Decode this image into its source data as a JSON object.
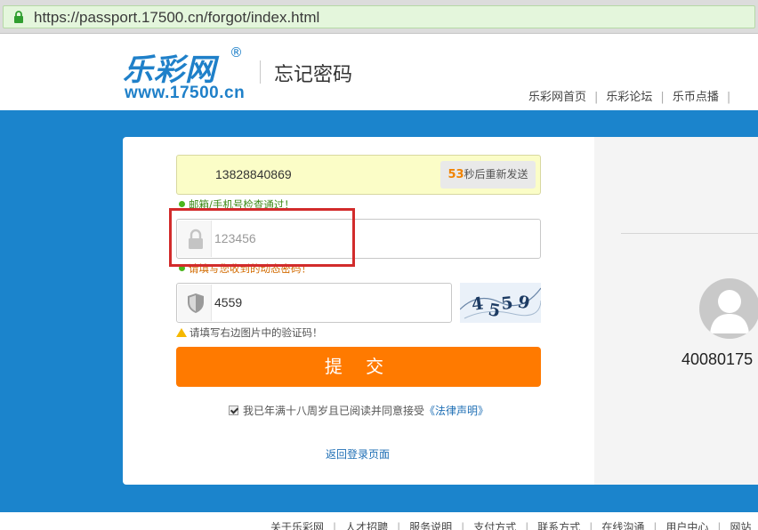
{
  "browser": {
    "url": "https://passport.17500.cn/forgot/index.html"
  },
  "header": {
    "logo_cn": "乐彩网",
    "logo_reg": "®",
    "logo_url": "www.17500.cn",
    "page_title": "忘记密码",
    "nav": [
      "乐彩网首页",
      "乐彩论坛",
      "乐币点播"
    ]
  },
  "form": {
    "phone_value": "13828840869",
    "resend_count": "53",
    "resend_text": "秒后重新发送",
    "phone_check_hint": "邮箱/手机号检查通过！",
    "code_placeholder": "123456",
    "code_hint": "请填写您收到的动态密码！",
    "captcha_value": "4559",
    "captcha_hint": "请填写右边图片中的验证码！",
    "captcha_image_text": "4559",
    "submit_label": "提 交",
    "agree_text": "我已年满十八周岁且已阅读并同意接受",
    "agree_link": "《法律声明》",
    "back_link": "返回登录页面"
  },
  "side": {
    "service_number": "40080175"
  },
  "footer": {
    "nav": [
      "关于乐彩网",
      "人才招聘",
      "服务说明",
      "支付方式",
      "联系方式",
      "在线沟通",
      "用户中心",
      "网站"
    ]
  },
  "colors": {
    "brand_blue": "#1b84cc",
    "submit_orange": "#ff7a00",
    "highlight_red": "#d22b2b"
  }
}
